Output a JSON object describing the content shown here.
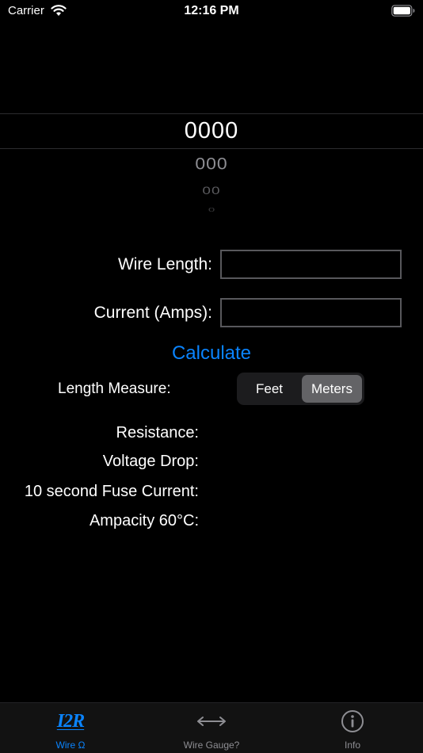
{
  "status_bar": {
    "carrier": "Carrier",
    "time": "12:16 PM",
    "icons": [
      "wifi-icon",
      "battery-icon"
    ]
  },
  "picker": {
    "selected": "0000",
    "rows": [
      "000",
      "00",
      "0"
    ]
  },
  "form": {
    "wire_length_label": "Wire Length:",
    "wire_length_value": "",
    "current_label": "Current (Amps):",
    "current_value": "",
    "calculate_label": "Calculate",
    "length_measure_label": "Length Measure:",
    "length_options": [
      "Feet",
      "Meters"
    ],
    "length_selected": "Meters"
  },
  "results": {
    "resistance_label": "Resistance:",
    "voltage_drop_label": "Voltage Drop:",
    "fuse_current_label": "10 second Fuse Current:",
    "ampacity_label": "Ampacity 60°C:"
  },
  "tab_bar": {
    "tabs": [
      {
        "label": "Wire Ω",
        "icon": "i2r-logo-icon",
        "logo_text": "I2R",
        "selected": true
      },
      {
        "label": "Wire Gauge?",
        "icon": "left-right-arrow-icon",
        "selected": false
      },
      {
        "label": "Info",
        "icon": "info-circle-icon",
        "selected": false
      }
    ]
  },
  "colors": {
    "accent": "#0a84ff",
    "background": "#000000",
    "segment_selected": "#636366",
    "tab_inactive": "#8e8e93"
  }
}
